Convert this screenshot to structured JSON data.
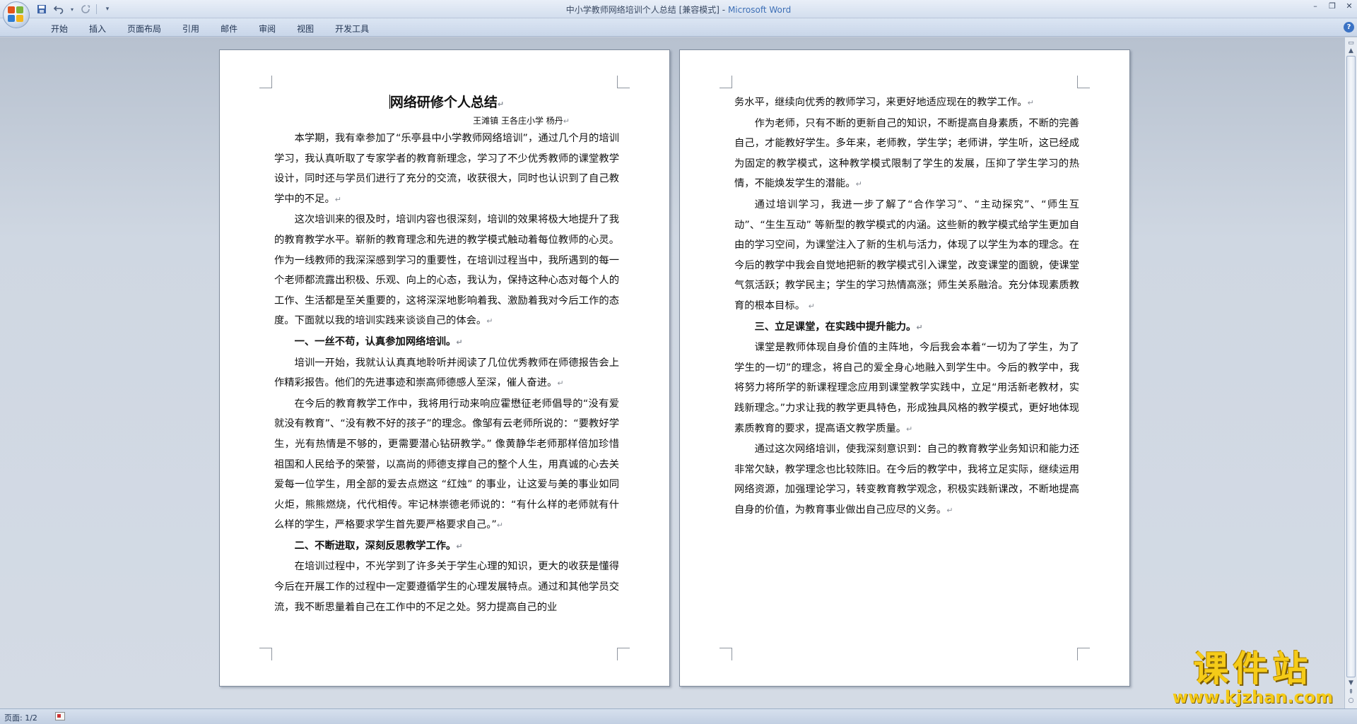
{
  "window": {
    "doc_name": "中小学教师网络培训个人总结",
    "mode": "[兼容模式]",
    "separator": " - ",
    "app_name": "Microsoft Word"
  },
  "qat": {
    "save_icon": "save-icon",
    "undo_icon": "undo-icon",
    "redo_icon": "redo-icon",
    "customize_icon": "dropdown-icon"
  },
  "ribbon": {
    "tabs": [
      "开始",
      "插入",
      "页面布局",
      "引用",
      "邮件",
      "审阅",
      "视图",
      "开发工具"
    ],
    "help_label": "?"
  },
  "document": {
    "title": "网络研修个人总结",
    "author": "王滩镇 王各庄小学 杨丹",
    "page1": [
      {
        "type": "p",
        "text": "本学期，我有幸参加了“乐亭县中小学教师网络培训”，通过几个月的培训学习，我认真听取了专家学者的教育新理念，学习了不少优秀教师的课堂教学设计，同时还与学员们进行了充分的交流，收获很大，同时也认识到了自己教学中的不足。"
      },
      {
        "type": "p",
        "text": "这次培训来的很及时，培训内容也很深刻，培训的效果将极大地提升了我的教育教学水平。崭新的教育理念和先进的教学模式触动着每位教师的心灵。作为一线教师的我深深感到学习的重要性，在培训过程当中，我所遇到的每一个老师都流露出积极、乐观、向上的心态，我认为，保持这种心态对每个人的工作、生活都是至关重要的，这将深深地影响着我、激励着我对今后工作的态度。下面就以我的培训实践来谈谈自己的体会。"
      },
      {
        "type": "h",
        "text": "一、一丝不苟，认真参加网络培训。"
      },
      {
        "type": "p",
        "text": "培训一开始，我就认认真真地聆听并阅读了几位优秀教师在师德报告会上作精彩报告。他们的先进事迹和崇高师德感人至深，催人奋进。"
      },
      {
        "type": "p",
        "text": "在今后的教育教学工作中，我将用行动来响应霍懋征老师倡导的“没有爱就没有教育”、“没有教不好的孩子”的理念。像邹有云老师所说的：“要教好学生，光有热情是不够的，更需要潜心钻研教学。” 像黄静华老师那样倍加珍惜祖国和人民给予的荣誉，以高尚的师德支撑自己的整个人生，用真诚的心去关爱每一位学生，用全部的爱去点燃这 “红烛” 的事业，让这爱与美的事业如同火炬，熊熊燃烧，代代相传。牢记林崇德老师说的：“有什么样的老师就有什么样的学生，严格要求学生首先要严格要求自己。”"
      },
      {
        "type": "h",
        "text": "二、不断进取，深刻反思教学工作。"
      },
      {
        "type": "p",
        "text": "在培训过程中，不光学到了许多关于学生心理的知识，更大的收获是懂得今后在开展工作的过程中一定要遵循学生的心理发展特点。通过和其他学员交流，我不断思量着自己在工作中的不足之处。努力提高自己的业",
        "cont": true
      }
    ],
    "page2": [
      {
        "type": "c",
        "text": "务水平，继续向优秀的教师学习，来更好地适应现在的教学工作。"
      },
      {
        "type": "p",
        "text": "作为老师，只有不断的更新自己的知识，不断提高自身素质，不断的完善自己，才能教好学生。多年来，老师教，学生学；老师讲，学生听，这已经成为固定的教学模式，这种教学模式限制了学生的发展，压抑了学生学习的热情，不能焕发学生的潜能。"
      },
      {
        "type": "p",
        "text": "通过培训学习，我进一步了解了“合作学习”、“主动探究”、“师生互动”、“生生互动” 等新型的教学模式的内涵。这些新的教学模式给学生更加自由的学习空间，为课堂注入了新的生机与活力，体现了以学生为本的理念。在今后的教学中我会自觉地把新的教学模式引入课堂，改变课堂的面貌，使课堂气氛活跃；教学民主；学生的学习热情高涨；师生关系融洽。充分体现素质教育的根本目标。 "
      },
      {
        "type": "h",
        "text": "三、立足课堂，在实践中提升能力。"
      },
      {
        "type": "p",
        "text": "课堂是教师体现自身价值的主阵地，今后我会本着“一切为了学生，为了学生的一切”的理念，将自己的爱全身心地融入到学生中。今后的教学中，我将努力将所学的新课程理念应用到课堂教学实践中，立足“用活新老教材，实践新理念。”力求让我的教学更具特色，形成独具风格的教学模式，更好地体现素质教育的要求，提高语文教学质量。"
      },
      {
        "type": "p",
        "text": "通过这次网络培训，使我深刻意识到：自己的教育教学业务知识和能力还非常欠缺，教学理念也比较陈旧。在今后的教学中，我将立足实际，继续运用网络资源，加强理论学习，转变教育教学观念，积极实践新课改，不断地提高自身的价值，为教育事业做出自己应尽的义务。"
      }
    ],
    "paragraph_mark": "↵"
  },
  "statusbar": {
    "page_indicator": "页面: 1/2"
  },
  "watermark": {
    "title": "课件站",
    "url": "www.kjzhan.com"
  }
}
